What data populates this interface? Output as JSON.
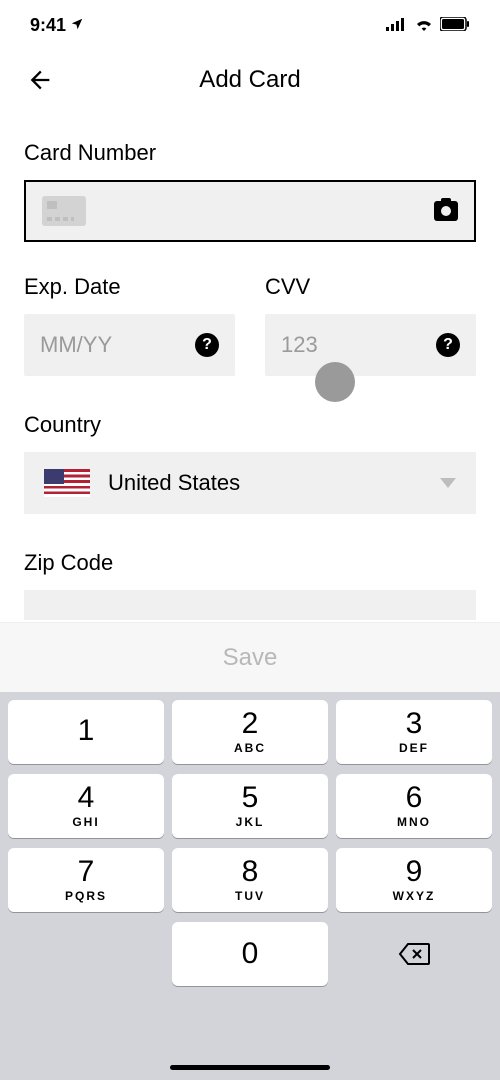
{
  "status": {
    "time": "9:41"
  },
  "header": {
    "title": "Add Card"
  },
  "form": {
    "cardNumber": {
      "label": "Card Number"
    },
    "expDate": {
      "label": "Exp. Date",
      "placeholder": "MM/YY"
    },
    "cvv": {
      "label": "CVV",
      "placeholder": "123"
    },
    "country": {
      "label": "Country",
      "selected": "United States"
    },
    "zip": {
      "label": "Zip Code"
    }
  },
  "actions": {
    "save": "Save"
  },
  "keypad": {
    "keys": [
      {
        "n": "1",
        "l": ""
      },
      {
        "n": "2",
        "l": "ABC"
      },
      {
        "n": "3",
        "l": "DEF"
      },
      {
        "n": "4",
        "l": "GHI"
      },
      {
        "n": "5",
        "l": "JKL"
      },
      {
        "n": "6",
        "l": "MNO"
      },
      {
        "n": "7",
        "l": "PQRS"
      },
      {
        "n": "8",
        "l": "TUV"
      },
      {
        "n": "9",
        "l": "WXYZ"
      },
      {
        "n": "0",
        "l": ""
      }
    ]
  }
}
